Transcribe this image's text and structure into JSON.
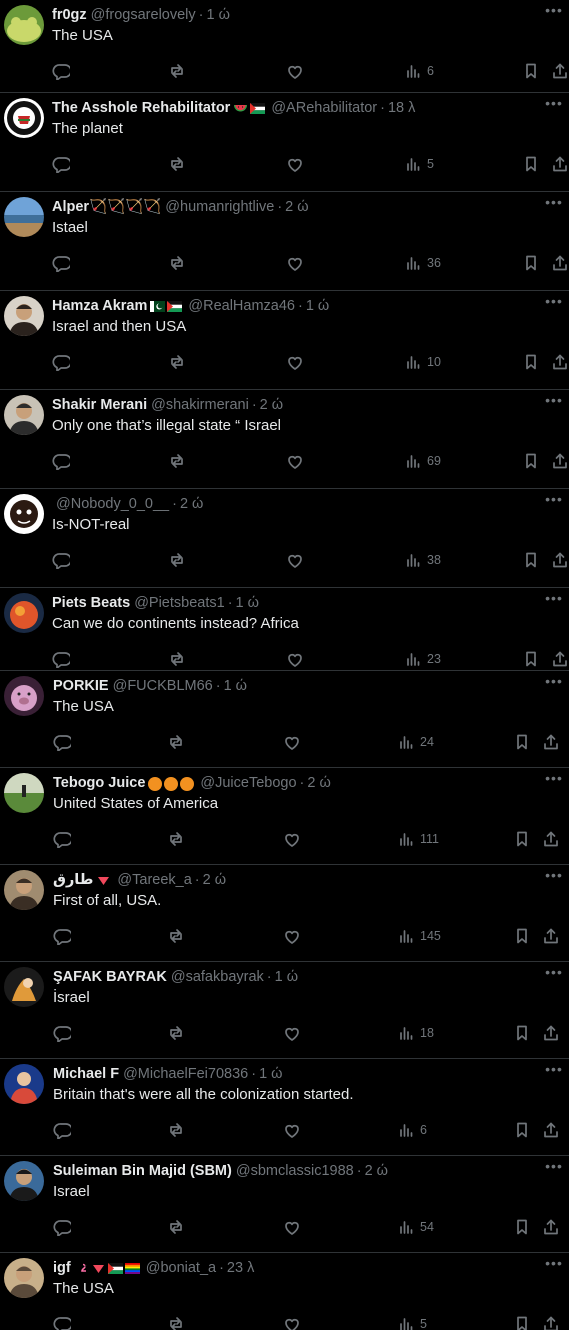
{
  "tweets": [
    {
      "name": "fr0gz",
      "badges": [],
      "handle": "@frogsarelovely",
      "sep": "·",
      "time": "1 ώ",
      "text": "The USA",
      "views": "6",
      "avatar": "frog",
      "colors": [
        "#c9d86a",
        "#6c9a3a"
      ]
    },
    {
      "name": "The Asshole Rehabilitator",
      "badges": [
        "watermelon",
        "palestine-flag"
      ],
      "handle": "@ARehabilitator",
      "sep": "·",
      "time": "18 λ",
      "text": "The planet",
      "views": "5",
      "avatar": "logo",
      "colors": [
        "#ffffff",
        "#111111"
      ]
    },
    {
      "name": "Alper🏹🏹🏹🏹",
      "badges": [],
      "handle": "@humanrightlive",
      "sep": "·",
      "time": "2 ώ",
      "text": "Istael",
      "views": "36",
      "avatar": "beach",
      "colors": [
        "#6fa3d8",
        "#b08a5a"
      ]
    },
    {
      "name": "Hamza Akram",
      "badges": [
        "pakistan-flag",
        "palestine-flag"
      ],
      "handle": "@RealHamza46",
      "sep": "·",
      "time": "1 ώ",
      "text": "Israel and then USA",
      "views": "10",
      "avatar": "person",
      "colors": [
        "#d8d2c8",
        "#2a221d"
      ]
    },
    {
      "name": "Shakir Merani",
      "badges": [],
      "handle": "@shakirmerani",
      "sep": "·",
      "time": "2 ώ",
      "text": "Only one that’s illegal state “ Israel",
      "views": "69",
      "avatar": "person",
      "colors": [
        "#c8c2b6",
        "#2c2c2c"
      ]
    },
    {
      "name": "",
      "badges": [],
      "handle": "@Nobody_0_0__",
      "sep": "·",
      "time": "2 ώ",
      "text": "Is-NOT-real",
      "views": "38",
      "avatar": "cartoon",
      "colors": [
        "#ffffff",
        "#2b1a12"
      ]
    },
    {
      "name": "Piets Beats",
      "badges": [],
      "handle": "@Pietsbeats1",
      "sep": "·",
      "time": "1 ώ",
      "text": "Can we do continents instead? Africa",
      "views": "23",
      "avatar": "planet",
      "colors": [
        "#1a2a44",
        "#e0552a"
      ]
    },
    {
      "name": "PORKIE",
      "badges": [],
      "handle": "@FUCKBLM66",
      "sep": "·",
      "time": "1 ώ",
      "text": "The USA",
      "views": "24",
      "avatar": "pig",
      "colors": [
        "#3a2036",
        "#d8a0c8"
      ]
    },
    {
      "name": "Tebogo Juice",
      "badges": [
        "orange",
        "orange",
        "orange"
      ],
      "handle": "@JuiceTebogo",
      "sep": "·",
      "time": "2 ώ",
      "text": "United States of America",
      "views": "111",
      "avatar": "field",
      "colors": [
        "#5a8a3a",
        "#cfd8c0"
      ]
    },
    {
      "name": "طارق",
      "badges": [
        "red-triangle"
      ],
      "handle": "@Tareek_a",
      "sep": "·",
      "time": "2 ώ",
      "text": "First of all, USA.",
      "views": "145",
      "avatar": "person",
      "colors": [
        "#a08c70",
        "#3a2e24"
      ]
    },
    {
      "name": "ŞAFAK BAYRAK",
      "badges": [],
      "handle": "@safakbayrak",
      "sep": "·",
      "time": "1 ώ",
      "text": "İsrael",
      "views": "18",
      "avatar": "fire",
      "colors": [
        "#1b1b1b",
        "#e09a3a"
      ]
    },
    {
      "name": "Michael F",
      "badges": [],
      "handle": "@MichaelFei70836",
      "sep": "·",
      "time": "1 ώ",
      "text": "Britain that's were all the colonization started.",
      "views": "6",
      "avatar": "blue",
      "colors": [
        "#1a3a8a",
        "#d84a3a"
      ]
    },
    {
      "name": "Suleiman Bin Majid (SBM)",
      "badges": [],
      "handle": "@sbmclassic1988",
      "sep": "·",
      "time": "2 ώ",
      "text": "Israel",
      "views": "54",
      "avatar": "person",
      "colors": [
        "#3a6a9a",
        "#1a1a1a"
      ]
    },
    {
      "name": "igf",
      "badges": [
        "flamingo",
        "red-triangle",
        "palestine-flag",
        "rainbow-flag"
      ],
      "handle": "@boniat_a",
      "sep": "·",
      "time": "23 λ",
      "text": "The USA",
      "views": "5",
      "avatar": "person",
      "colors": [
        "#c8b08a",
        "#5a4a3a"
      ]
    }
  ],
  "icons": {
    "reply": "reply-icon",
    "retweet": "retweet-icon",
    "like": "heart-icon",
    "views": "views-icon",
    "bookmark": "bookmark-icon",
    "share": "share-icon",
    "more": "more-icon"
  },
  "colors": {
    "background": "#000000",
    "text": "#e7e9ea",
    "muted": "#71767b",
    "divider": "#2f3336"
  }
}
